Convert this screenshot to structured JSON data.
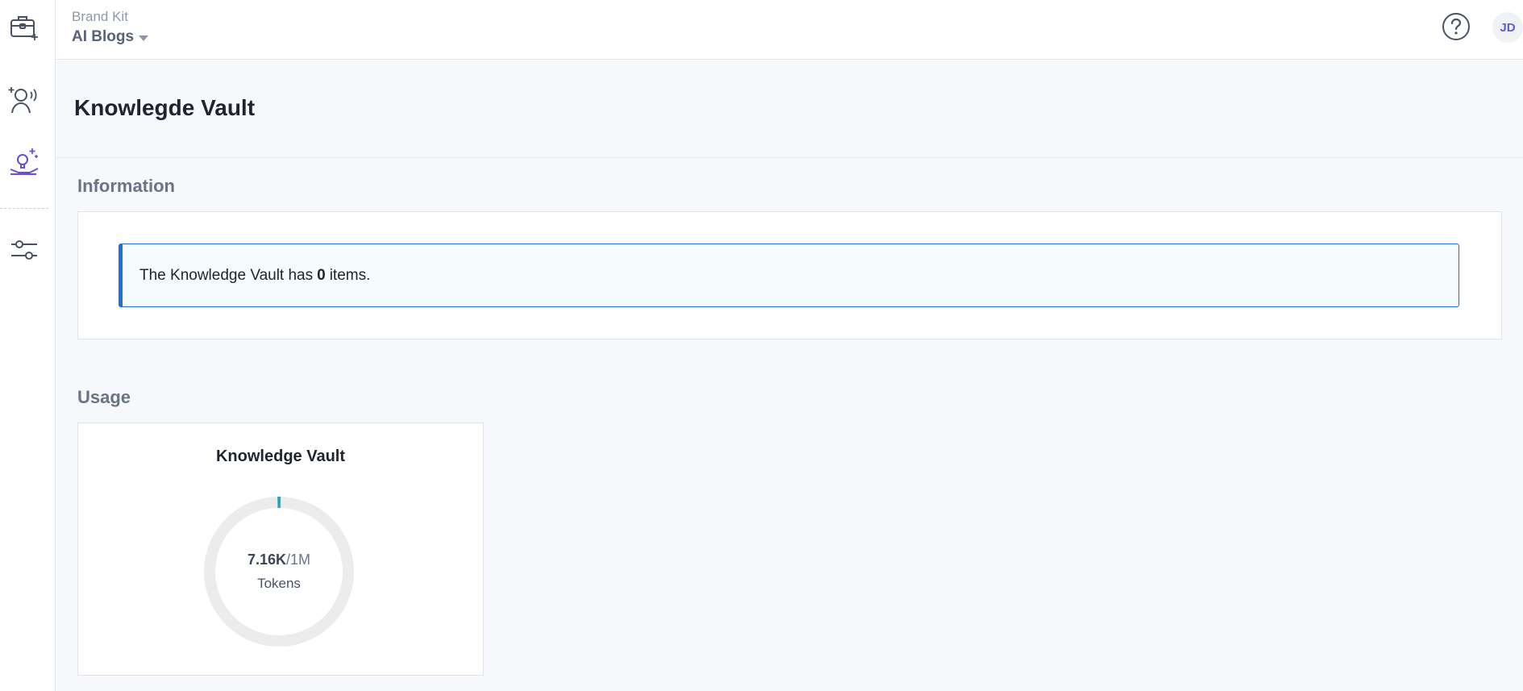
{
  "header": {
    "brand_label": "Brand Kit",
    "brand_value": "AI Blogs",
    "user_initials": "JD"
  },
  "sidebar": {
    "items": [
      {
        "name": "brand-kit",
        "icon": "briefcase-sparkle-icon"
      },
      {
        "name": "persona",
        "icon": "person-voice-sparkle-icon"
      },
      {
        "name": "knowledge-vault",
        "icon": "lightbulb-hand-sparkle-icon",
        "active": true
      },
      {
        "name": "settings",
        "icon": "sliders-icon"
      }
    ]
  },
  "page": {
    "title": "Knowlegde Vault"
  },
  "information": {
    "section_title": "Information",
    "alert_prefix": "The Knowledge Vault has",
    "alert_count": "0",
    "alert_suffix": "items."
  },
  "usage": {
    "section_title": "Usage",
    "card_title": "Knowledge Vault",
    "used": "7.16K",
    "separator": "/",
    "limit": "1M",
    "unit_label": "Tokens",
    "used_fraction": 0.00716
  },
  "colors": {
    "accent": "#1f6fd9",
    "active_icon": "#6a4fd6",
    "gauge_fill": "#29a6b7",
    "gauge_track": "#ececec"
  }
}
